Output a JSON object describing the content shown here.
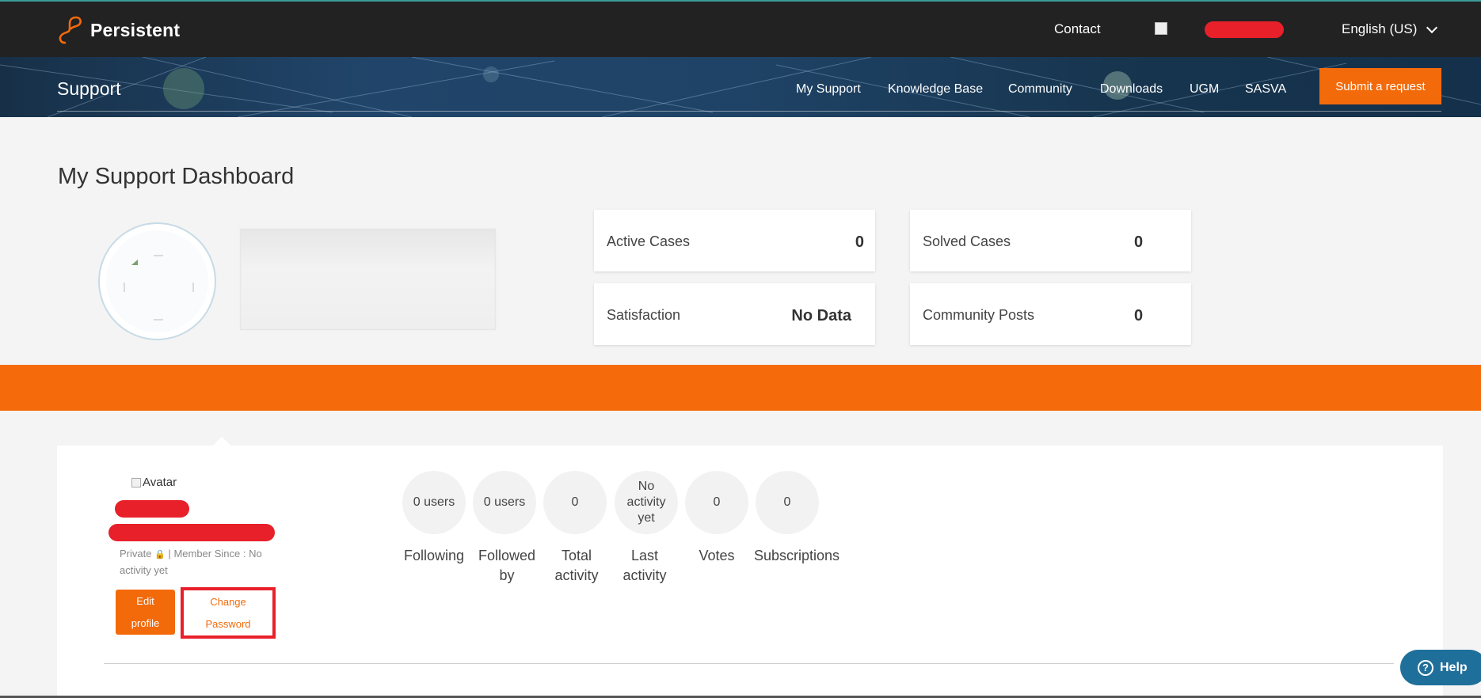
{
  "header": {
    "brand": "Persistent",
    "contact": "Contact",
    "language": "English (US)",
    "brand_color": "#f36a0b"
  },
  "banner": {
    "title": "Support",
    "nav": [
      "My Support",
      "Knowledge Base",
      "Community",
      "Downloads",
      "UGM",
      "SASVA"
    ],
    "submit_label": "Submit a request"
  },
  "dashboard": {
    "title": "My Support Dashboard",
    "stats": {
      "active_cases": {
        "label": "Active Cases",
        "value": "0"
      },
      "solved_cases": {
        "label": "Solved Cases",
        "value": "0"
      },
      "satisfaction": {
        "label": "Satisfaction",
        "value": "No Data"
      },
      "community_posts": {
        "label": "Community Posts",
        "value": "0"
      }
    }
  },
  "profile": {
    "avatar_alt": "Avatar",
    "privacy": "Private",
    "member_since": "Member Since : No activity yet",
    "edit_line1": "Edit",
    "edit_line2": "profile",
    "change_line1": "Change",
    "change_line2": "Password",
    "stats": [
      {
        "value": "0 users",
        "label": "Following"
      },
      {
        "value": "0 users",
        "label": "Followed by"
      },
      {
        "value": "0",
        "label": "Total activity"
      },
      {
        "value": "No activity yet",
        "label": "Last activity"
      },
      {
        "value": "0",
        "label": "Votes"
      },
      {
        "value": "0",
        "label": "Subscriptions"
      }
    ]
  },
  "help": {
    "label": "Help"
  }
}
